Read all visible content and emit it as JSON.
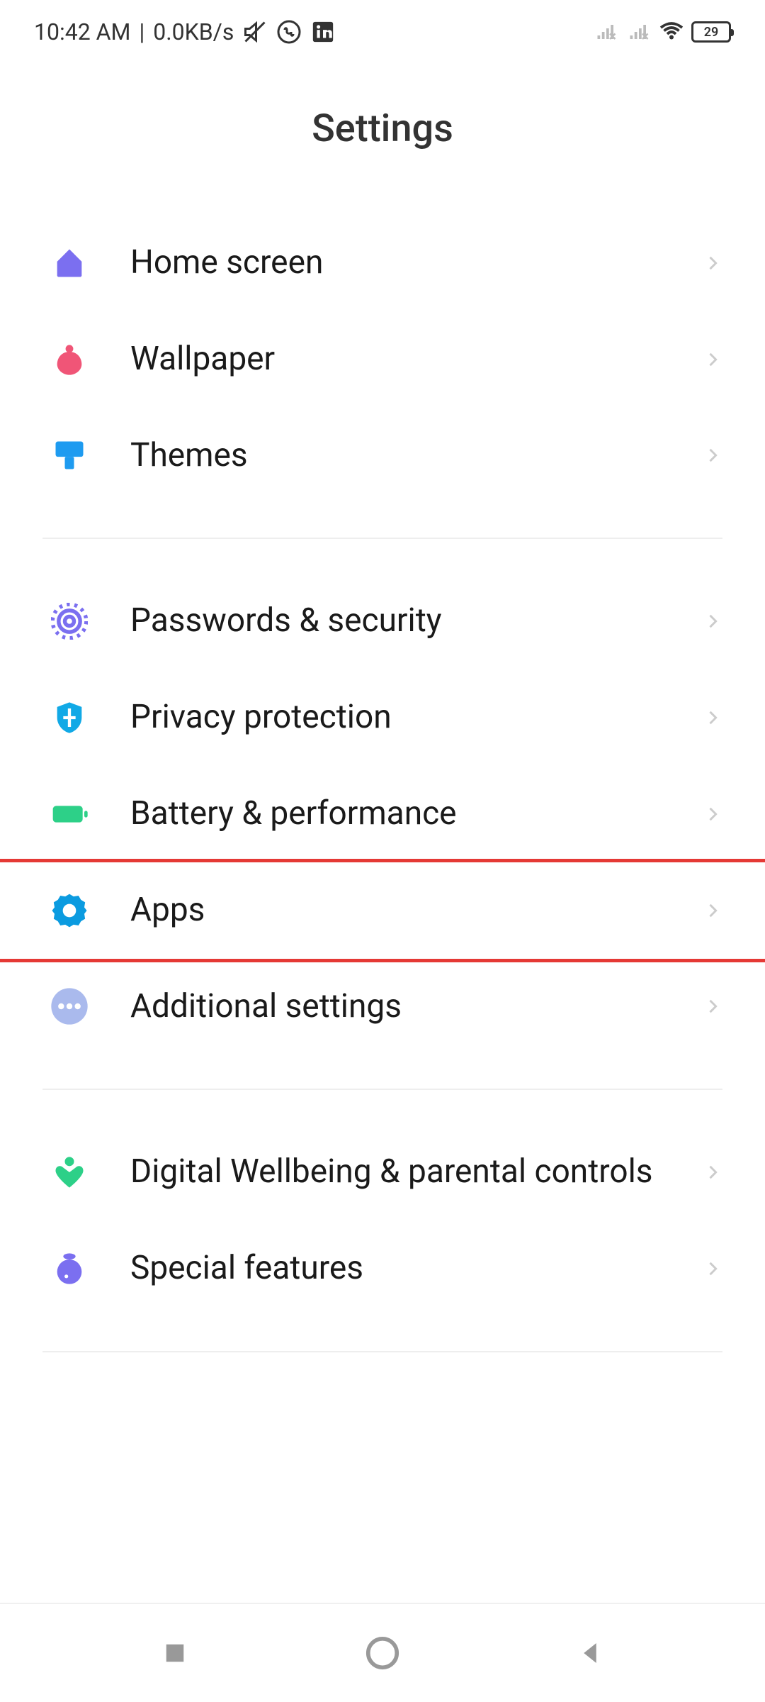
{
  "statusBar": {
    "time": "10:42 AM",
    "dataRate": "0.0KB/s",
    "batteryLevel": "29"
  },
  "pageTitle": "Settings",
  "groups": [
    {
      "items": [
        {
          "key": "home-screen",
          "label": "Home screen",
          "iconColor": "#7b6ff0"
        },
        {
          "key": "wallpaper",
          "label": "Wallpaper",
          "iconColor": "#f05577"
        },
        {
          "key": "themes",
          "label": "Themes",
          "iconColor": "#1e9bf0"
        }
      ]
    },
    {
      "items": [
        {
          "key": "passwords-security",
          "label": "Passwords & security",
          "iconColor": "#7b6ff0"
        },
        {
          "key": "privacy-protection",
          "label": "Privacy protection",
          "iconColor": "#11a9e6"
        },
        {
          "key": "battery-performance",
          "label": "Battery & performance",
          "iconColor": "#2dd088"
        },
        {
          "key": "apps",
          "label": "Apps",
          "iconColor": "#0b9be0",
          "highlighted": true
        },
        {
          "key": "additional-settings",
          "label": "Additional settings",
          "iconColor": "#aabaed"
        }
      ]
    },
    {
      "items": [
        {
          "key": "digital-wellbeing",
          "label": "Digital Wellbeing & parental controls",
          "iconColor": "#2dd088"
        },
        {
          "key": "special-features",
          "label": "Special features",
          "iconColor": "#7b6ff0"
        }
      ]
    }
  ]
}
